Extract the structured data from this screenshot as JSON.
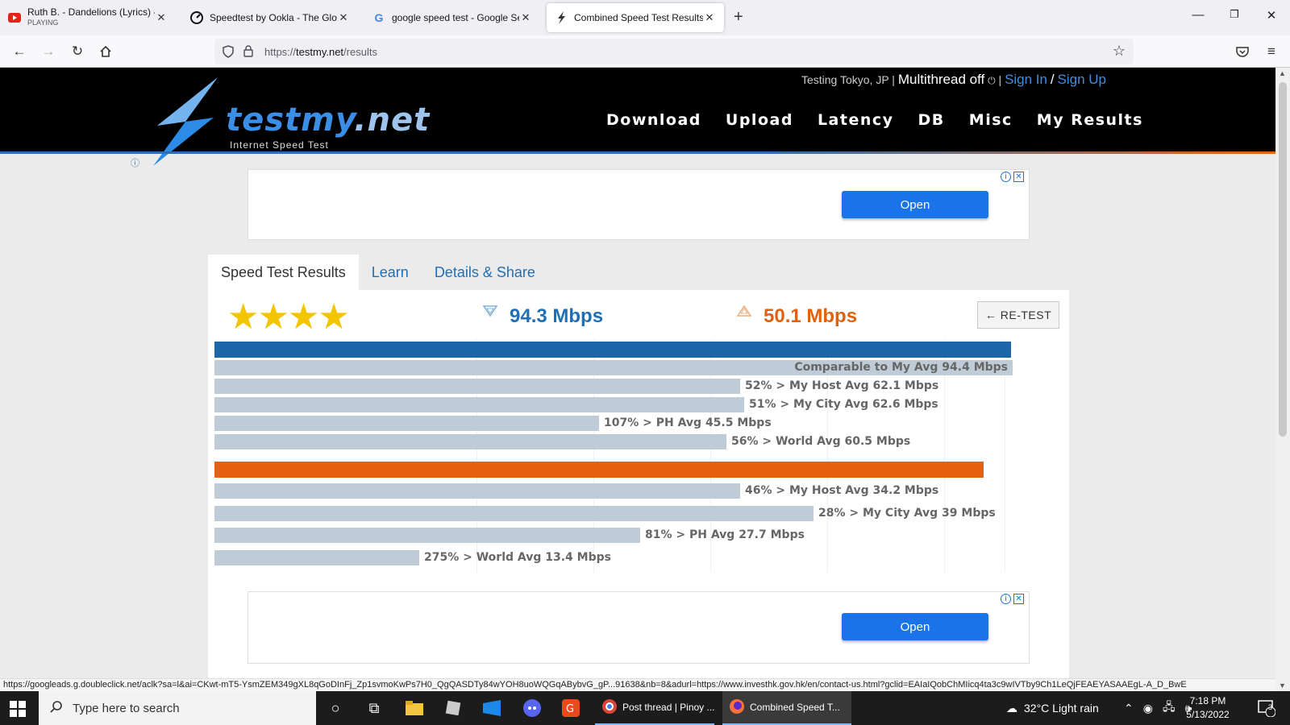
{
  "browser": {
    "tabs": [
      {
        "title": "Ruth B. - Dandelions (Lyrics) - Y",
        "subtitle": "PLAYING"
      },
      {
        "title": "Speedtest by Ookla - The Global"
      },
      {
        "title": "google speed test - Google Sear"
      },
      {
        "title": "Combined Speed Test Results"
      }
    ],
    "url_scheme": "https://",
    "url_domain": "testmy.net",
    "url_path": "/results"
  },
  "site": {
    "topline": {
      "testing": "Testing Tokyo, JP",
      "sep1": "|",
      "multithread": "Multithread off",
      "sep2": "|",
      "sign_in": "Sign In",
      "slash": "/",
      "sign_up": "Sign Up"
    },
    "logo": {
      "word_main": "testmy",
      "word_net": ".net",
      "sub": "Internet Speed Test"
    },
    "nav": [
      "Download",
      "Upload",
      "Latency",
      "DB",
      "Misc",
      "My Results"
    ],
    "ad_open": "Open"
  },
  "results": {
    "tabs": [
      "Speed Test Results",
      "Learn",
      "Details & Share"
    ],
    "stars": 4,
    "download": "94.3 Mbps",
    "upload": "50.1 Mbps",
    "retest": "← RE-TEST",
    "download_bars": [
      {
        "label": "Comparable to My Avg 94.4 Mbps",
        "fraction": 1.0
      },
      {
        "label": "52% > My Host Avg 62.1 Mbps",
        "fraction": 0.659
      },
      {
        "label": "51% > My City Avg 62.6 Mbps",
        "fraction": 0.664
      },
      {
        "label": "107% > PH Avg 45.5 Mbps",
        "fraction": 0.482
      },
      {
        "label": "56% > World Avg 60.5 Mbps",
        "fraction": 0.641
      }
    ],
    "upload_bars": [
      {
        "label": "46% > My Host Avg 34.2 Mbps",
        "fraction": 0.659
      },
      {
        "label": "28% > My City Avg 39 Mbps",
        "fraction": 0.751
      },
      {
        "label": "81% > PH Avg 27.7 Mbps",
        "fraction": 0.533
      },
      {
        "label": "275% > World Avg 13.4 Mbps",
        "fraction": 0.257
      }
    ],
    "download_main_fraction": 0.998,
    "upload_main_fraction": 0.964
  },
  "statusbar": "https://googleads.g.doubleclick.net/aclk?sa=l&ai=CKwt-mT5-YsmZEM349gXL8qGoDInFj_Zp1svmoKwPs7H0_QgQASDTy84wYOH8uoWQGqABybvG_gP...91638&nb=8&adurl=https://www.investhk.gov.hk/en/contact-us.html?gclid=EAIaIQobChMIicq4ta3c9wIVTby9Ch1LeQjFEAEYASAAEgL-A_D_BwE",
  "taskbar": {
    "search_placeholder": "Type here to search",
    "apps": [
      "Post thread | Pinoy ...",
      "Combined Speed T..."
    ],
    "weather": "32°C  Light rain",
    "time": "7:18 PM",
    "date": "5/13/2022",
    "notifications": "3"
  }
}
